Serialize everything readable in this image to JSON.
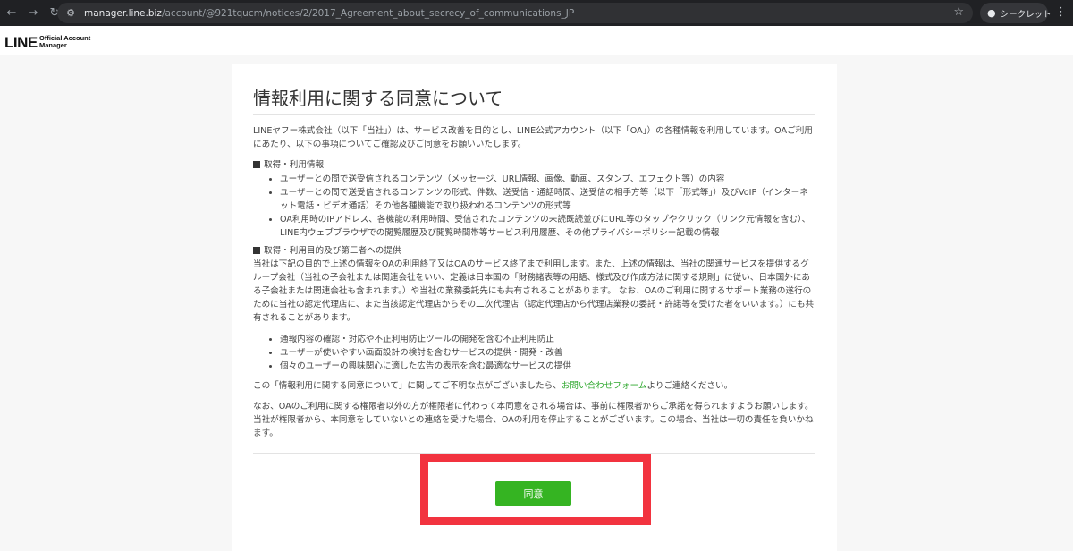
{
  "browser": {
    "url_host": "manager.line.biz",
    "url_path": "/account/@921tqucm/notices/2/2017_Agreement_about_secrecy_of_communications_JP",
    "incognito_label": "シークレット"
  },
  "header": {
    "logo_main": "LINE",
    "logo_sub": "Official Account\nManager"
  },
  "page": {
    "title": "情報利用に関する同意について",
    "intro": "LINEヤフー株式会社（以下「当社」）は、サービス改善を目的とし、LINE公式アカウント（以下「OA」）の各種情報を利用しています。OAご利用にあたり、以下の事項についてご確認及びご同意をお願いいたします。",
    "section1_title": "取得・利用情報",
    "section1_items": [
      "ユーザーとの間で送受信されるコンテンツ（メッセージ、URL情報、画像、動画、スタンプ、エフェクト等）の内容",
      "ユーザーとの間で送受信されるコンテンツの形式、件数、送受信・通話時間、送受信の相手方等（以下「形式等」）及びVoIP（インターネット電話・ビデオ通話）その他各種機能で取り扱われるコンテンツの形式等",
      "OA利用時のIPアドレス、各機能の利用時間、受信されたコンテンツの未読既読並びにURL等のタップやクリック（リンク元情報を含む）、LINE内ウェブブラウザでの閲覧履歴及び閲覧時間帯等サービス利用履歴、その他プライバシーポリシー記載の情報"
    ],
    "section2_title": "取得・利用目的及び第三者への提供",
    "section2_body": "当社は下記の目的で上述の情報をOAの利用終了又はOAのサービス終了まで利用します。また、上述の情報は、当社の関連サービスを提供するグループ会社（当社の子会社または関連会社をいい、定義は日本国の「財務諸表等の用語、様式及び作成方法に関する規則」に従い、日本国外にある子会社または関連会社も含まれます。）や当社の業務委託先にも共有されることがあります。 なお、OAのご利用に関するサポート業務の遂行のために当社の認定代理店に、また当該認定代理店からその二次代理店（認定代理店から代理店業務の委託・許諾等を受けた者をいいます。）にも共有されることがあります。",
    "section2_items": [
      "通報内容の確認・対応や不正利用防止ツールの開発を含む不正利用防止",
      "ユーザーが使いやすい画面設計の検討を含むサービスの提供・開発・改善",
      "個々のユーザーの興味関心に適した広告の表示を含む最適なサービスの提供"
    ],
    "contact_before": "この「情報利用に関する同意について」に関してご不明な点がございましたら、",
    "contact_link": "お問い合わせフォーム",
    "contact_after": "よりご連絡ください。",
    "notice": "なお、OAのご利用に関する権限者以外の方が権限者に代わって本同意をされる場合は、事前に権限者からご承諾を得られますようお願いします。当社が権限者から、本同意をしていないとの連絡を受けた場合、OAの利用を停止することがございます。この場合、当社は一切の責任を負いかねます。",
    "agree_label": "同意"
  },
  "colors": {
    "accent_green": "#35b422",
    "link_green": "#2fa82f",
    "highlight_red": "#f2333f"
  }
}
